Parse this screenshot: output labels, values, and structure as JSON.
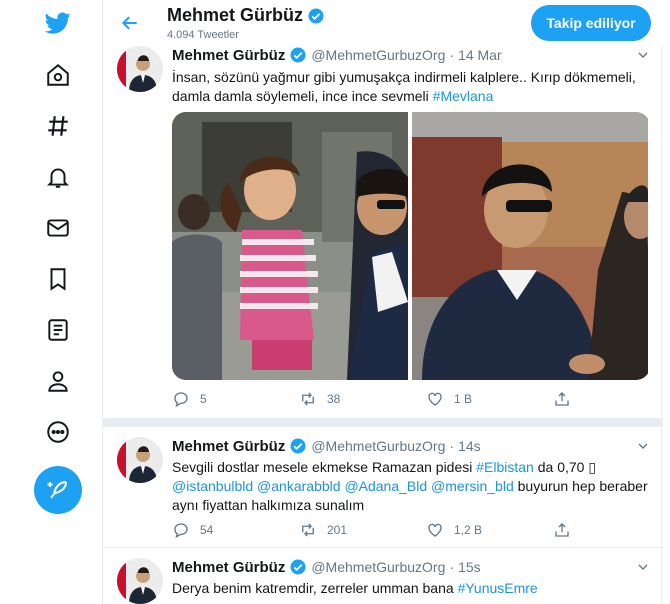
{
  "header": {
    "name": "Mehmet Gürbüz",
    "tweet_count": "4.094 Tweetler",
    "follow_label": "Takip ediliyor"
  },
  "nav": {
    "items": [
      "twitter-logo",
      "home-icon",
      "explore-icon",
      "notifications-icon",
      "messages-icon",
      "bookmarks-icon",
      "lists-icon",
      "profile-icon",
      "more-icon"
    ]
  },
  "tweets": [
    {
      "name": "Mehmet Gürbüz",
      "handle": "@MehmetGurbuzOrg",
      "sep": "·",
      "time": "14 Mar",
      "text": "İnsan, sözünü yağmur gibi yumuşakça indirmeli kalplere.. Kırıp dökmemeli, damla damla söylemeli, ince ince sevmeli",
      "hashtag": "#Mevlana",
      "replies": "5",
      "retweets": "38",
      "likes": "1 B"
    },
    {
      "name": "Mehmet Gürbüz",
      "handle": "@MehmetGurbuzOrg",
      "sep": "·",
      "time": "14s",
      "text_a": "Sevgili dostlar mesele ekmekse Ramazan pidesi",
      "hashtag_a": "#Elbistan",
      "text_b": "da 0,70 ",
      "glyph": "▯",
      "mention_1": "@istanbulbld",
      "mention_2": "@ankarabbld",
      "mention_3": "@Adana_Bld",
      "mention_4": "@mersin_bld",
      "text_c": "buyurun hep beraber",
      "text_d": "aynı fiyattan halkımıza sunalım",
      "replies": "54",
      "retweets": "201",
      "likes": "1,2 B"
    },
    {
      "name": "Mehmet Gürbüz",
      "handle": "@MehmetGurbuzOrg",
      "sep": "·",
      "time": "15s",
      "text": "Derya benim katremdir, zerreler umman bana",
      "hashtag": "#YunusEmre"
    }
  ],
  "colors": {
    "accent": "#1da1f2",
    "link": "#1b95e0",
    "muted": "#657786",
    "divider": "#e6ecf0"
  }
}
